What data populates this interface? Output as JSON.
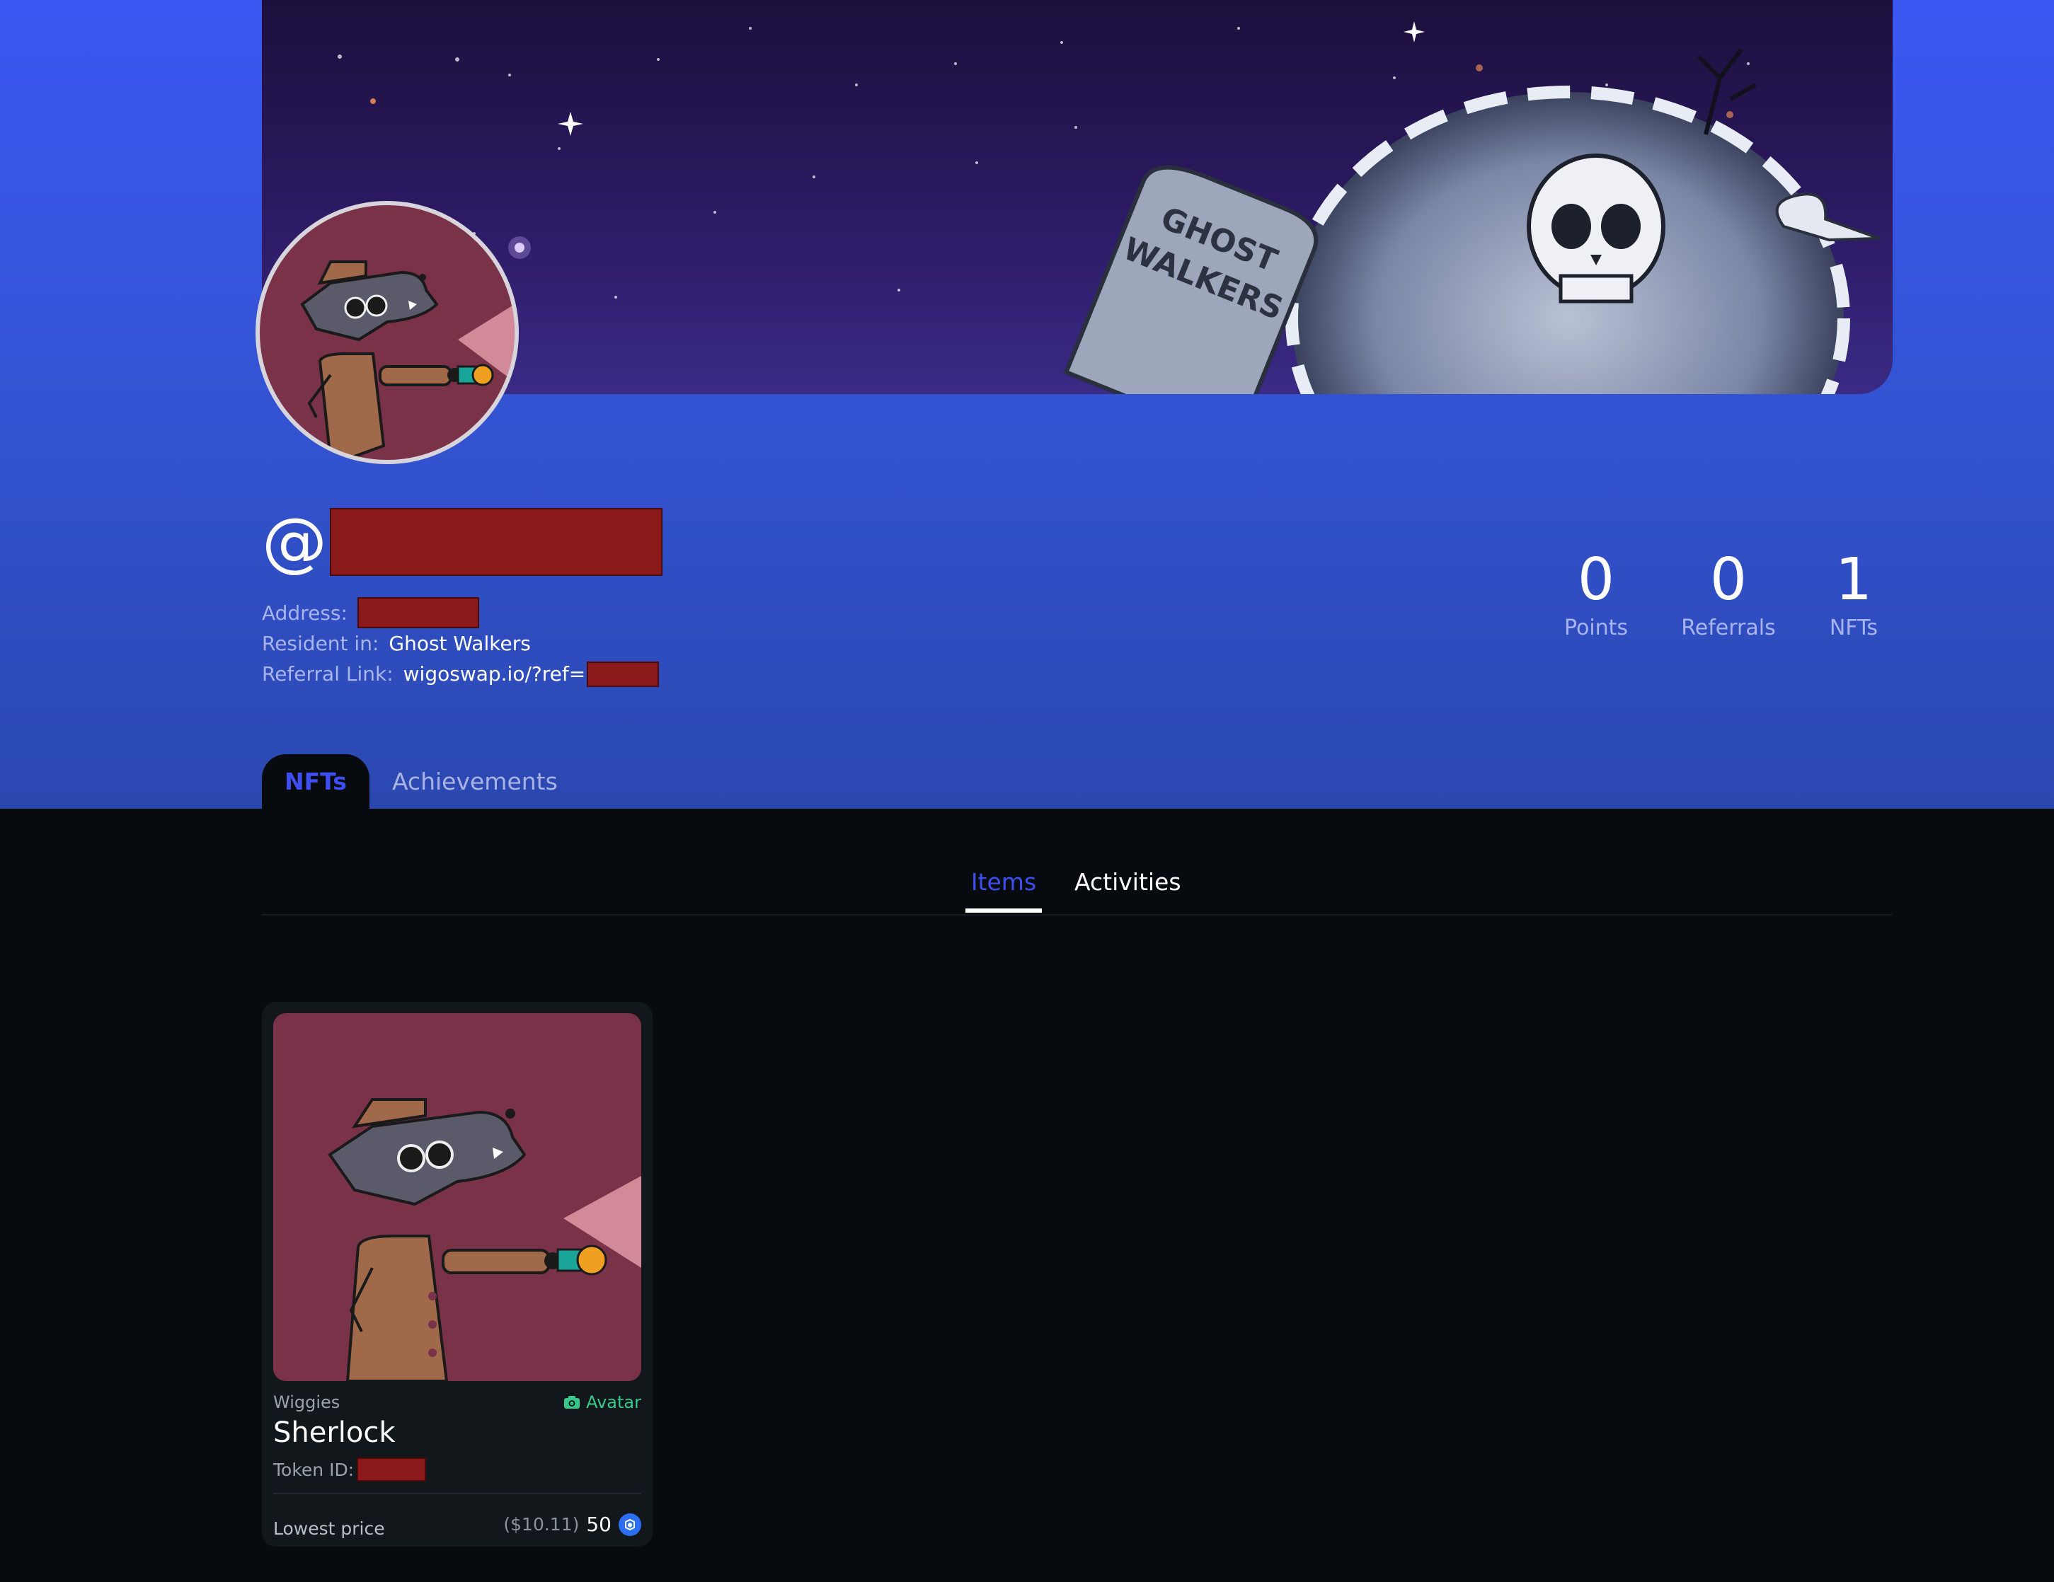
{
  "profile": {
    "at_symbol": "@",
    "address_label": "Address:",
    "resident_label": "Resident in:",
    "resident_value": "Ghost Walkers",
    "referral_label": "Referral Link:",
    "referral_value": "wigoswap.io/?ref="
  },
  "banner": {
    "tombstone_line1": "GHOST",
    "tombstone_line2": "WALKERS"
  },
  "stats": [
    {
      "value": "0",
      "label": "Points"
    },
    {
      "value": "0",
      "label": "Referrals"
    },
    {
      "value": "1",
      "label": "NFTs"
    }
  ],
  "main_tabs": [
    {
      "label": "NFTs",
      "active": true
    },
    {
      "label": "Achievements",
      "active": false
    }
  ],
  "sub_tabs": [
    {
      "label": "Items",
      "active": true
    },
    {
      "label": "Activities",
      "active": false
    }
  ],
  "nft_card": {
    "collection": "Wiggies",
    "badge_label": "Avatar",
    "name": "Sherlock",
    "token_label": "Token ID:",
    "price_label": "Lowest price",
    "price_usd": "($10.11)",
    "price_amount": "50",
    "coin_icon": "wigo-coin-icon"
  },
  "colors": {
    "accent": "#3d4ff2",
    "hero_top": "#3b57f2",
    "hero_bottom": "#2b48b0",
    "page_bg": "#070b0f",
    "avatar_bg": "#7a3249",
    "badge_green": "#36c88a",
    "redaction": "#8b1a1a"
  }
}
